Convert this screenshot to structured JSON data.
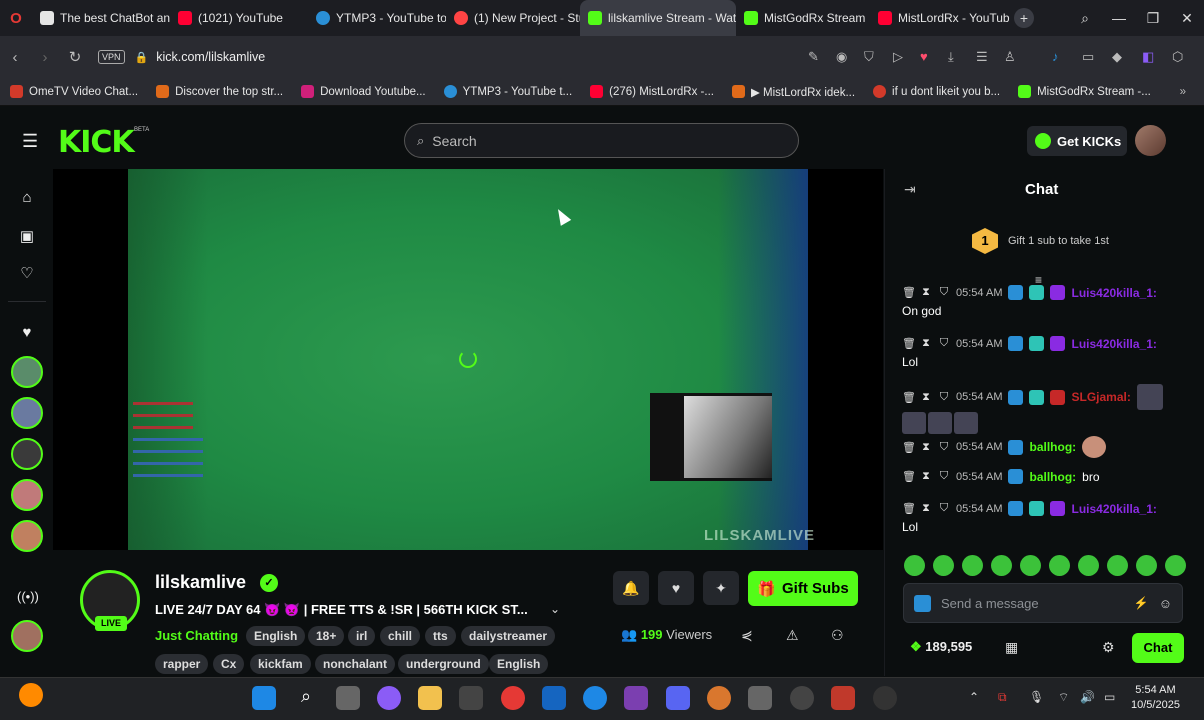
{
  "browser": {
    "tabs": [
      {
        "label": "The best ChatBot and",
        "color": "#e5e5e5"
      },
      {
        "label": "(1021) YouTube",
        "color": "#ff0033"
      },
      {
        "label": "YTMP3 - YouTube to",
        "color": "#2a8fd6"
      },
      {
        "label": "(1) New Project - Stud",
        "color": "#ff4444"
      },
      {
        "label": "lilskamlive Stream - Watc",
        "color": "#53fc18",
        "active": true
      },
      {
        "label": "MistGodRx Stream",
        "color": "#53fc18"
      },
      {
        "label": "MistLordRx - YouTube",
        "color": "#ff0033"
      }
    ],
    "new_tab": "+",
    "vpn": "VPN",
    "url": "kick.com/lilskamlive",
    "bookmarks": [
      {
        "label": "OmeTV Video Chat...",
        "color": "#d23a2a"
      },
      {
        "label": "Discover the top str...",
        "color": "#e06a1a"
      },
      {
        "label": "Download Youtube...",
        "color": "#d0207a"
      },
      {
        "label": "YTMP3 - YouTube t...",
        "color": "#2a8fd6"
      },
      {
        "label": "(276) MistLordRx -...",
        "color": "#ff0033"
      },
      {
        "label": "▶ MistLordRx idek...",
        "color": "#e06a1a"
      },
      {
        "label": "if u dont likeit you b...",
        "color": "#d23a2a"
      },
      {
        "label": "MistGodRx Stream -...",
        "color": "#53fc18"
      }
    ]
  },
  "kick": {
    "logo": "KICK",
    "beta": "BETA",
    "search_placeholder": "Search",
    "get_kicks": "Get KICKs",
    "accent": "#53fc18"
  },
  "stream": {
    "watermark": "LILSKAMLIVE"
  },
  "channel": {
    "name": "lilskamlive",
    "live_badge": "LIVE",
    "title": "LIVE 24/7 DAY 64 😈 👿 | FREE TTS & !SR | 566TH KICK ST...",
    "category": "Just Chatting",
    "tags_row1": [
      "English",
      "18+",
      "irl",
      "chill",
      "tts",
      "dailystreamer"
    ],
    "tags_row2": [
      "rapper",
      "Cx",
      "kickfam",
      "nonchalant",
      "underground",
      "English"
    ],
    "gift_subs": "Gift Subs",
    "viewers_count": "199",
    "viewers_label": "Viewers"
  },
  "chat": {
    "title": "Chat",
    "gift_banner_num": "1",
    "gift_banner": "Gift 1 sub to take 1st",
    "messages": [
      {
        "time": "05:54 AM",
        "user": "Luis420killa_1:",
        "user_color": "#8a2be2",
        "text": "On god"
      },
      {
        "time": "05:54 AM",
        "user": "Luis420killa_1:",
        "user_color": "#8a2be2",
        "text": "Lol"
      },
      {
        "time": "05:54 AM",
        "user": "SLGjamal:",
        "user_color": "#c62828",
        "text": ""
      },
      {
        "time": "05:54 AM",
        "user": "ballhog:",
        "user_color": "#53fc18",
        "text": ""
      },
      {
        "time": "05:54 AM",
        "user": "ballhog:",
        "user_color": "#53fc18",
        "text": "bro"
      },
      {
        "time": "05:54 AM",
        "user": "Luis420killa_1:",
        "user_color": "#8a2be2",
        "text": "Lol"
      }
    ],
    "send_placeholder": "Send a message",
    "points": "189,595",
    "chat_button": "Chat"
  },
  "taskbar": {
    "time": "5:54 AM",
    "date": "10/5/2025"
  }
}
